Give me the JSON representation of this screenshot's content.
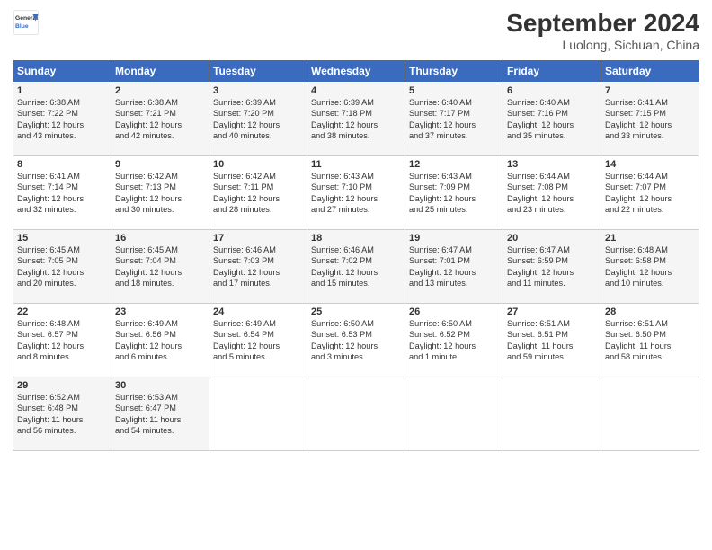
{
  "logo": {
    "line1": "General",
    "line2": "Blue"
  },
  "title": "September 2024",
  "subtitle": "Luolong, Sichuan, China",
  "days_of_week": [
    "Sunday",
    "Monday",
    "Tuesday",
    "Wednesday",
    "Thursday",
    "Friday",
    "Saturday"
  ],
  "weeks": [
    [
      {
        "day": 1,
        "info": "Sunrise: 6:38 AM\nSunset: 7:22 PM\nDaylight: 12 hours\nand 43 minutes."
      },
      {
        "day": 2,
        "info": "Sunrise: 6:38 AM\nSunset: 7:21 PM\nDaylight: 12 hours\nand 42 minutes."
      },
      {
        "day": 3,
        "info": "Sunrise: 6:39 AM\nSunset: 7:20 PM\nDaylight: 12 hours\nand 40 minutes."
      },
      {
        "day": 4,
        "info": "Sunrise: 6:39 AM\nSunset: 7:18 PM\nDaylight: 12 hours\nand 38 minutes."
      },
      {
        "day": 5,
        "info": "Sunrise: 6:40 AM\nSunset: 7:17 PM\nDaylight: 12 hours\nand 37 minutes."
      },
      {
        "day": 6,
        "info": "Sunrise: 6:40 AM\nSunset: 7:16 PM\nDaylight: 12 hours\nand 35 minutes."
      },
      {
        "day": 7,
        "info": "Sunrise: 6:41 AM\nSunset: 7:15 PM\nDaylight: 12 hours\nand 33 minutes."
      }
    ],
    [
      {
        "day": 8,
        "info": "Sunrise: 6:41 AM\nSunset: 7:14 PM\nDaylight: 12 hours\nand 32 minutes."
      },
      {
        "day": 9,
        "info": "Sunrise: 6:42 AM\nSunset: 7:13 PM\nDaylight: 12 hours\nand 30 minutes."
      },
      {
        "day": 10,
        "info": "Sunrise: 6:42 AM\nSunset: 7:11 PM\nDaylight: 12 hours\nand 28 minutes."
      },
      {
        "day": 11,
        "info": "Sunrise: 6:43 AM\nSunset: 7:10 PM\nDaylight: 12 hours\nand 27 minutes."
      },
      {
        "day": 12,
        "info": "Sunrise: 6:43 AM\nSunset: 7:09 PM\nDaylight: 12 hours\nand 25 minutes."
      },
      {
        "day": 13,
        "info": "Sunrise: 6:44 AM\nSunset: 7:08 PM\nDaylight: 12 hours\nand 23 minutes."
      },
      {
        "day": 14,
        "info": "Sunrise: 6:44 AM\nSunset: 7:07 PM\nDaylight: 12 hours\nand 22 minutes."
      }
    ],
    [
      {
        "day": 15,
        "info": "Sunrise: 6:45 AM\nSunset: 7:05 PM\nDaylight: 12 hours\nand 20 minutes."
      },
      {
        "day": 16,
        "info": "Sunrise: 6:45 AM\nSunset: 7:04 PM\nDaylight: 12 hours\nand 18 minutes."
      },
      {
        "day": 17,
        "info": "Sunrise: 6:46 AM\nSunset: 7:03 PM\nDaylight: 12 hours\nand 17 minutes."
      },
      {
        "day": 18,
        "info": "Sunrise: 6:46 AM\nSunset: 7:02 PM\nDaylight: 12 hours\nand 15 minutes."
      },
      {
        "day": 19,
        "info": "Sunrise: 6:47 AM\nSunset: 7:01 PM\nDaylight: 12 hours\nand 13 minutes."
      },
      {
        "day": 20,
        "info": "Sunrise: 6:47 AM\nSunset: 6:59 PM\nDaylight: 12 hours\nand 11 minutes."
      },
      {
        "day": 21,
        "info": "Sunrise: 6:48 AM\nSunset: 6:58 PM\nDaylight: 12 hours\nand 10 minutes."
      }
    ],
    [
      {
        "day": 22,
        "info": "Sunrise: 6:48 AM\nSunset: 6:57 PM\nDaylight: 12 hours\nand 8 minutes."
      },
      {
        "day": 23,
        "info": "Sunrise: 6:49 AM\nSunset: 6:56 PM\nDaylight: 12 hours\nand 6 minutes."
      },
      {
        "day": 24,
        "info": "Sunrise: 6:49 AM\nSunset: 6:54 PM\nDaylight: 12 hours\nand 5 minutes."
      },
      {
        "day": 25,
        "info": "Sunrise: 6:50 AM\nSunset: 6:53 PM\nDaylight: 12 hours\nand 3 minutes."
      },
      {
        "day": 26,
        "info": "Sunrise: 6:50 AM\nSunset: 6:52 PM\nDaylight: 12 hours\nand 1 minute."
      },
      {
        "day": 27,
        "info": "Sunrise: 6:51 AM\nSunset: 6:51 PM\nDaylight: 11 hours\nand 59 minutes."
      },
      {
        "day": 28,
        "info": "Sunrise: 6:51 AM\nSunset: 6:50 PM\nDaylight: 11 hours\nand 58 minutes."
      }
    ],
    [
      {
        "day": 29,
        "info": "Sunrise: 6:52 AM\nSunset: 6:48 PM\nDaylight: 11 hours\nand 56 minutes."
      },
      {
        "day": 30,
        "info": "Sunrise: 6:53 AM\nSunset: 6:47 PM\nDaylight: 11 hours\nand 54 minutes."
      },
      null,
      null,
      null,
      null,
      null
    ]
  ]
}
